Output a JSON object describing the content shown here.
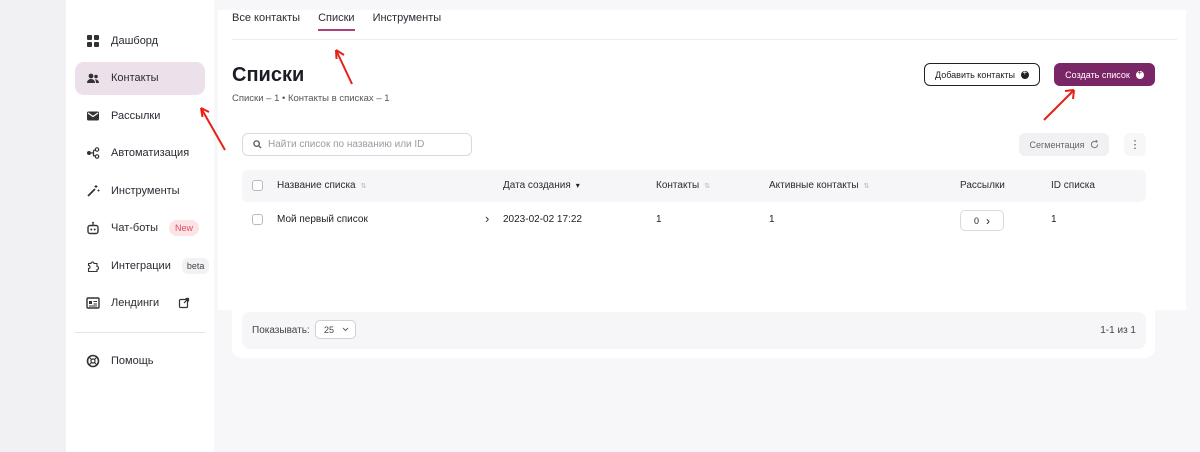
{
  "sidebar": {
    "items": [
      {
        "label": "Дашборд",
        "icon": "dashboard-grid-icon"
      },
      {
        "label": "Контакты",
        "icon": "contacts-icon",
        "active": true
      },
      {
        "label": "Рассылки",
        "icon": "mail-icon"
      },
      {
        "label": "Автоматизация",
        "icon": "automation-nodes-icon"
      },
      {
        "label": "Инструменты",
        "icon": "magic-wand-icon"
      },
      {
        "label": "Чат-боты",
        "icon": "robot-icon",
        "badge": "New"
      },
      {
        "label": "Интеграции",
        "icon": "puzzle-icon",
        "badge": "beta"
      },
      {
        "label": "Лендинги",
        "icon": "landing-page-icon"
      }
    ],
    "help_label": "Помощь"
  },
  "tabs": [
    {
      "label": "Все контакты"
    },
    {
      "label": "Списки",
      "active": true
    },
    {
      "label": "Инструменты"
    }
  ],
  "page": {
    "title": "Списки",
    "subtitle": "Списки – 1 • Контакты в списках – 1"
  },
  "actions": {
    "add_contacts": "Добавить контакты",
    "create_list": "Создать список"
  },
  "toolbar": {
    "search_placeholder": "Найти список по названию или ID",
    "segmentation": "Сегментация"
  },
  "table": {
    "columns": [
      "Название списка",
      "Дата создания",
      "Контакты",
      "Активные контакты",
      "Рассылки",
      "ID списка"
    ],
    "rows": [
      {
        "name": "Мой первый список",
        "created": "2023-02-02 17:22",
        "contacts": "1",
        "active_contacts": "1",
        "mailings": "0",
        "id": "1"
      }
    ]
  },
  "footer": {
    "show_label": "Показывать:",
    "per_page": "25",
    "pager": "1-1 из 1"
  },
  "colors": {
    "accent": "#7a2566",
    "active_nav": "#ece0eb",
    "annotation": "#e8201a",
    "badge_new": "#e14a5f"
  }
}
